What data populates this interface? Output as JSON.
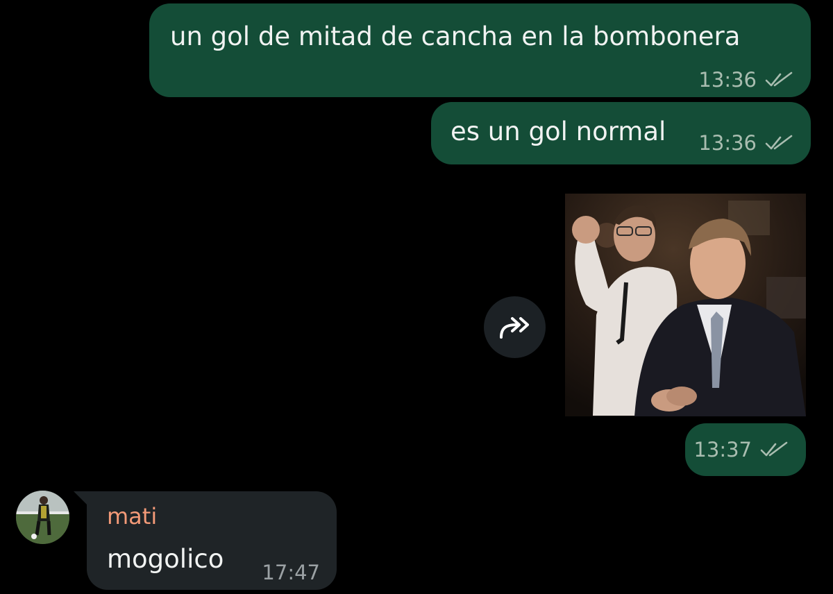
{
  "messages": [
    {
      "direction": "out",
      "text": "un gol de mitad de cancha en la bombonera",
      "time": "13:36",
      "status_icon": "double-check-icon"
    },
    {
      "direction": "out",
      "text": "es un gol normal",
      "time": "13:36",
      "status_icon": "double-check-icon"
    },
    {
      "direction": "out",
      "media": "gif",
      "time": "13:37",
      "status_icon": "double-check-icon"
    },
    {
      "direction": "in",
      "sender": "mati",
      "text": "mogolico",
      "time": "17:47"
    }
  ],
  "forward_icon": "forward-icon",
  "colors": {
    "background": "#000000",
    "outgoing_bubble": "#144d37",
    "incoming_bubble": "#1f2427",
    "sender_name": "#f39a78",
    "message_text": "#f1f3f2",
    "outgoing_meta": "#a9bdb0",
    "incoming_meta": "#9ba1a4"
  }
}
